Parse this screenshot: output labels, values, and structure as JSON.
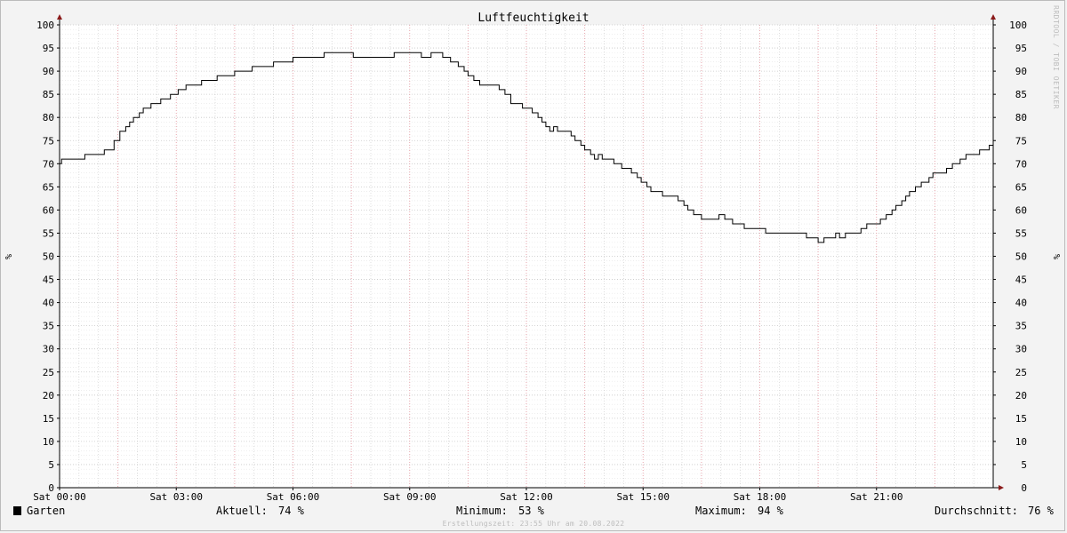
{
  "chart_data": {
    "type": "line",
    "title": "Luftfeuchtigkeit",
    "ylabel": "%",
    "ylim": [
      0,
      100
    ],
    "yticks": [
      0,
      5,
      10,
      15,
      20,
      25,
      30,
      35,
      40,
      45,
      50,
      55,
      60,
      65,
      70,
      75,
      80,
      85,
      90,
      95,
      100
    ],
    "xlim_hours": [
      0,
      24
    ],
    "xticks": [
      {
        "hour": 0,
        "label": "Sat 00:00"
      },
      {
        "hour": 3,
        "label": "Sat 03:00"
      },
      {
        "hour": 6,
        "label": "Sat 06:00"
      },
      {
        "hour": 9,
        "label": "Sat 09:00"
      },
      {
        "hour": 12,
        "label": "Sat 12:00"
      },
      {
        "hour": 15,
        "label": "Sat 15:00"
      },
      {
        "hour": 18,
        "label": "Sat 18:00"
      },
      {
        "hour": 21,
        "label": "Sat 21:00"
      }
    ],
    "grid": true,
    "series": [
      {
        "name": "Garten",
        "color": "#000000",
        "points": [
          [
            0.0,
            70
          ],
          [
            0.05,
            71
          ],
          [
            0.65,
            72
          ],
          [
            1.15,
            73
          ],
          [
            1.4,
            75
          ],
          [
            1.55,
            77
          ],
          [
            1.7,
            78
          ],
          [
            1.8,
            79
          ],
          [
            1.9,
            80
          ],
          [
            2.05,
            81
          ],
          [
            2.15,
            82
          ],
          [
            2.35,
            83
          ],
          [
            2.6,
            84
          ],
          [
            2.85,
            85
          ],
          [
            2.95,
            85
          ],
          [
            3.05,
            86
          ],
          [
            3.25,
            87
          ],
          [
            3.65,
            88
          ],
          [
            4.05,
            89
          ],
          [
            4.5,
            90
          ],
          [
            4.95,
            91
          ],
          [
            5.5,
            92
          ],
          [
            6.0,
            93
          ],
          [
            6.8,
            94
          ],
          [
            7.55,
            93
          ],
          [
            8.6,
            94
          ],
          [
            9.3,
            93
          ],
          [
            9.55,
            94
          ],
          [
            9.85,
            93
          ],
          [
            10.05,
            92
          ],
          [
            10.25,
            91
          ],
          [
            10.4,
            90
          ],
          [
            10.5,
            89
          ],
          [
            10.65,
            88
          ],
          [
            10.8,
            87
          ],
          [
            11.3,
            86
          ],
          [
            11.45,
            85
          ],
          [
            11.6,
            83
          ],
          [
            11.9,
            82
          ],
          [
            12.15,
            81
          ],
          [
            12.3,
            80
          ],
          [
            12.4,
            79
          ],
          [
            12.5,
            78
          ],
          [
            12.6,
            77
          ],
          [
            12.7,
            78
          ],
          [
            12.8,
            77
          ],
          [
            13.15,
            76
          ],
          [
            13.25,
            75
          ],
          [
            13.4,
            74
          ],
          [
            13.5,
            73
          ],
          [
            13.65,
            72
          ],
          [
            13.75,
            71
          ],
          [
            13.85,
            72
          ],
          [
            13.95,
            71
          ],
          [
            14.25,
            70
          ],
          [
            14.45,
            69
          ],
          [
            14.7,
            68
          ],
          [
            14.85,
            67
          ],
          [
            14.95,
            66
          ],
          [
            15.1,
            65
          ],
          [
            15.2,
            64
          ],
          [
            15.5,
            63
          ],
          [
            15.9,
            62
          ],
          [
            16.05,
            61
          ],
          [
            16.15,
            60
          ],
          [
            16.3,
            59
          ],
          [
            16.5,
            58
          ],
          [
            16.95,
            59
          ],
          [
            17.1,
            58
          ],
          [
            17.3,
            57
          ],
          [
            17.6,
            56
          ],
          [
            18.15,
            55
          ],
          [
            19.2,
            54
          ],
          [
            19.5,
            53
          ],
          [
            19.65,
            54
          ],
          [
            19.95,
            55
          ],
          [
            20.05,
            54
          ],
          [
            20.2,
            55
          ],
          [
            20.6,
            56
          ],
          [
            20.75,
            57
          ],
          [
            21.1,
            58
          ],
          [
            21.25,
            59
          ],
          [
            21.4,
            60
          ],
          [
            21.5,
            61
          ],
          [
            21.65,
            62
          ],
          [
            21.75,
            63
          ],
          [
            21.85,
            64
          ],
          [
            22.0,
            65
          ],
          [
            22.15,
            66
          ],
          [
            22.35,
            67
          ],
          [
            22.45,
            68
          ],
          [
            22.8,
            69
          ],
          [
            22.95,
            70
          ],
          [
            23.15,
            71
          ],
          [
            23.3,
            72
          ],
          [
            23.65,
            73
          ],
          [
            23.9,
            74
          ],
          [
            24.0,
            74
          ]
        ]
      }
    ]
  },
  "legend": {
    "series_name": "Garten",
    "current_label": "Aktuell:",
    "current_value": "74 %",
    "min_label": "Minimum:",
    "min_value": "53 %",
    "max_label": "Maximum:",
    "max_value": "94 %",
    "avg_label": "Durchschnitt:",
    "avg_value": "76 %"
  },
  "credits": {
    "created": "Erstellungszeit: 23:55 Uhr am 20.08.2022",
    "vertical": "RRDTOOL / TOBI OETIKER"
  },
  "colors": {
    "grid_minor": "#c8c8c8",
    "grid_major_vertical": "#e8a0a8",
    "axis": "#000000",
    "arrow": "#8b1a1a",
    "plot_bg": "#ffffff",
    "page_bg": "#f3f3f3"
  }
}
